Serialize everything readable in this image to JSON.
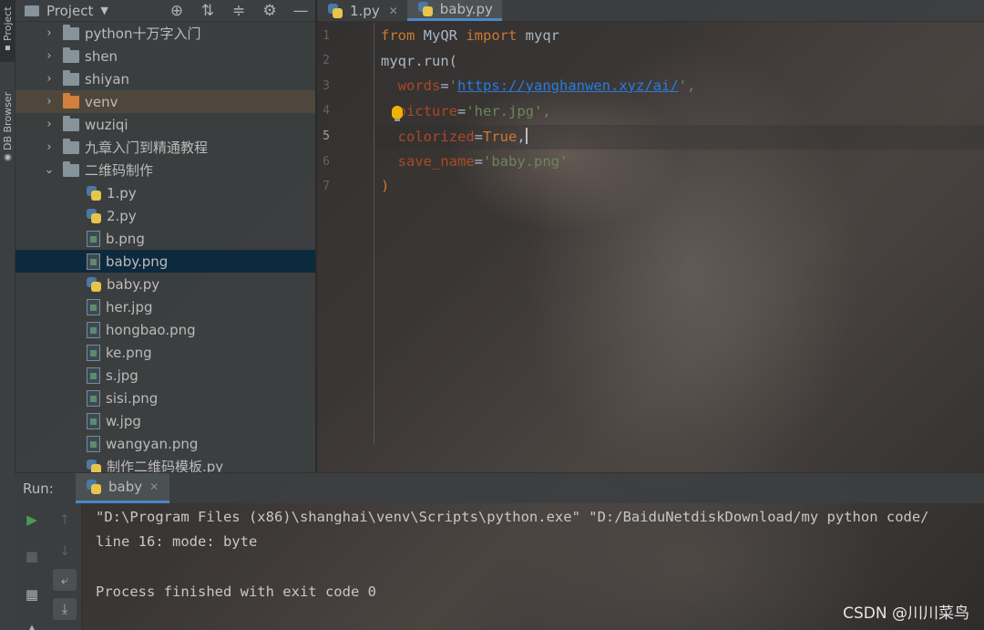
{
  "sidebar_tabs": {
    "project": "Project",
    "db": "DB Browser"
  },
  "project_panel": {
    "title": "Project",
    "header_icons": [
      "target-icon",
      "expand-all-icon",
      "collapse-all-icon",
      "gear-icon",
      "minimize-icon"
    ],
    "tree": [
      {
        "label": "python十万字入门",
        "type": "folder",
        "expanded": false
      },
      {
        "label": "shen",
        "type": "folder",
        "expanded": false
      },
      {
        "label": "shiyan",
        "type": "folder",
        "expanded": false
      },
      {
        "label": "venv",
        "type": "folder",
        "expanded": false,
        "excluded": true
      },
      {
        "label": "wuziqi",
        "type": "folder",
        "expanded": false
      },
      {
        "label": "九章入门到精通教程",
        "type": "folder",
        "expanded": false
      },
      {
        "label": "二维码制作",
        "type": "folder",
        "expanded": true
      },
      {
        "label": "1.py",
        "type": "py"
      },
      {
        "label": "2.py",
        "type": "py"
      },
      {
        "label": "b.png",
        "type": "image"
      },
      {
        "label": "baby.png",
        "type": "image",
        "selected": true
      },
      {
        "label": "baby.py",
        "type": "py"
      },
      {
        "label": "her.jpg",
        "type": "image"
      },
      {
        "label": "hongbao.png",
        "type": "image"
      },
      {
        "label": "ke.png",
        "type": "image"
      },
      {
        "label": "s.jpg",
        "type": "image"
      },
      {
        "label": "sisi.png",
        "type": "image"
      },
      {
        "label": "w.jpg",
        "type": "image"
      },
      {
        "label": "wangyan.png",
        "type": "image"
      },
      {
        "label": "制作二维码模板.py",
        "type": "py"
      }
    ]
  },
  "editor": {
    "tabs": [
      {
        "label": "1.py",
        "active": false
      },
      {
        "label": "baby.py",
        "active": true
      }
    ],
    "line_numbers": [
      "1",
      "2",
      "3",
      "4",
      "5",
      "6",
      "7"
    ],
    "current_line": "5",
    "code": {
      "l1_from": "from",
      "l1_module": " MyQR ",
      "l1_import": "import",
      "l1_name": " myqr",
      "l2": "myqr.run(",
      "l3_param": "words",
      "l3_eq": "=",
      "l3_q1": "'",
      "l3_url": "https://yanghanwen.xyz/ai/",
      "l3_q2": "',",
      "l4_param": "picture",
      "l4_eq": "=",
      "l4_val": "'her.jpg',",
      "l5_param": "colorized",
      "l5_eq": "=",
      "l5_val": "True",
      "l5_comma": ",",
      "l6_param": "save_name",
      "l6_eq": "=",
      "l6_val": "'baby.png'",
      "l7": ")"
    }
  },
  "run_panel": {
    "label": "Run:",
    "tab": "baby",
    "output": [
      "\"D:\\Program Files (x86)\\shanghai\\venv\\Scripts\\python.exe\" \"D:/BaiduNetdiskDownload/my python code/",
      "line 16: mode: byte",
      "",
      "Process finished with exit code 0"
    ]
  },
  "watermark": "CSDN @川川菜鸟",
  "colors": {
    "keyword": "#cc7832",
    "param": "#aa4926",
    "string": "#6a8759",
    "link": "#287bde",
    "selection": "#0d293e",
    "accent": "#4a88c7"
  }
}
